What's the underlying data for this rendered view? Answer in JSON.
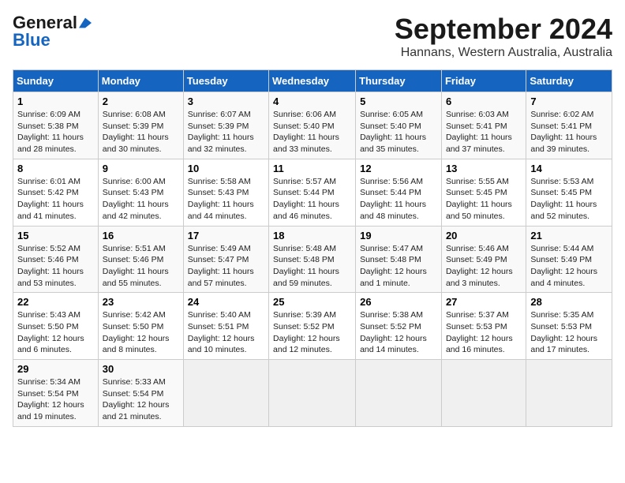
{
  "logo": {
    "line1": "General",
    "line2": "Blue"
  },
  "title": "September 2024",
  "subtitle": "Hannans, Western Australia, Australia",
  "days_of_week": [
    "Sunday",
    "Monday",
    "Tuesday",
    "Wednesday",
    "Thursday",
    "Friday",
    "Saturday"
  ],
  "weeks": [
    [
      {
        "day": "1",
        "info": "Sunrise: 6:09 AM\nSunset: 5:38 PM\nDaylight: 11 hours\nand 28 minutes."
      },
      {
        "day": "2",
        "info": "Sunrise: 6:08 AM\nSunset: 5:39 PM\nDaylight: 11 hours\nand 30 minutes."
      },
      {
        "day": "3",
        "info": "Sunrise: 6:07 AM\nSunset: 5:39 PM\nDaylight: 11 hours\nand 32 minutes."
      },
      {
        "day": "4",
        "info": "Sunrise: 6:06 AM\nSunset: 5:40 PM\nDaylight: 11 hours\nand 33 minutes."
      },
      {
        "day": "5",
        "info": "Sunrise: 6:05 AM\nSunset: 5:40 PM\nDaylight: 11 hours\nand 35 minutes."
      },
      {
        "day": "6",
        "info": "Sunrise: 6:03 AM\nSunset: 5:41 PM\nDaylight: 11 hours\nand 37 minutes."
      },
      {
        "day": "7",
        "info": "Sunrise: 6:02 AM\nSunset: 5:41 PM\nDaylight: 11 hours\nand 39 minutes."
      }
    ],
    [
      {
        "day": "8",
        "info": "Sunrise: 6:01 AM\nSunset: 5:42 PM\nDaylight: 11 hours\nand 41 minutes."
      },
      {
        "day": "9",
        "info": "Sunrise: 6:00 AM\nSunset: 5:43 PM\nDaylight: 11 hours\nand 42 minutes."
      },
      {
        "day": "10",
        "info": "Sunrise: 5:58 AM\nSunset: 5:43 PM\nDaylight: 11 hours\nand 44 minutes."
      },
      {
        "day": "11",
        "info": "Sunrise: 5:57 AM\nSunset: 5:44 PM\nDaylight: 11 hours\nand 46 minutes."
      },
      {
        "day": "12",
        "info": "Sunrise: 5:56 AM\nSunset: 5:44 PM\nDaylight: 11 hours\nand 48 minutes."
      },
      {
        "day": "13",
        "info": "Sunrise: 5:55 AM\nSunset: 5:45 PM\nDaylight: 11 hours\nand 50 minutes."
      },
      {
        "day": "14",
        "info": "Sunrise: 5:53 AM\nSunset: 5:45 PM\nDaylight: 11 hours\nand 52 minutes."
      }
    ],
    [
      {
        "day": "15",
        "info": "Sunrise: 5:52 AM\nSunset: 5:46 PM\nDaylight: 11 hours\nand 53 minutes."
      },
      {
        "day": "16",
        "info": "Sunrise: 5:51 AM\nSunset: 5:46 PM\nDaylight: 11 hours\nand 55 minutes."
      },
      {
        "day": "17",
        "info": "Sunrise: 5:49 AM\nSunset: 5:47 PM\nDaylight: 11 hours\nand 57 minutes."
      },
      {
        "day": "18",
        "info": "Sunrise: 5:48 AM\nSunset: 5:48 PM\nDaylight: 11 hours\nand 59 minutes."
      },
      {
        "day": "19",
        "info": "Sunrise: 5:47 AM\nSunset: 5:48 PM\nDaylight: 12 hours\nand 1 minute."
      },
      {
        "day": "20",
        "info": "Sunrise: 5:46 AM\nSunset: 5:49 PM\nDaylight: 12 hours\nand 3 minutes."
      },
      {
        "day": "21",
        "info": "Sunrise: 5:44 AM\nSunset: 5:49 PM\nDaylight: 12 hours\nand 4 minutes."
      }
    ],
    [
      {
        "day": "22",
        "info": "Sunrise: 5:43 AM\nSunset: 5:50 PM\nDaylight: 12 hours\nand 6 minutes."
      },
      {
        "day": "23",
        "info": "Sunrise: 5:42 AM\nSunset: 5:50 PM\nDaylight: 12 hours\nand 8 minutes."
      },
      {
        "day": "24",
        "info": "Sunrise: 5:40 AM\nSunset: 5:51 PM\nDaylight: 12 hours\nand 10 minutes."
      },
      {
        "day": "25",
        "info": "Sunrise: 5:39 AM\nSunset: 5:52 PM\nDaylight: 12 hours\nand 12 minutes."
      },
      {
        "day": "26",
        "info": "Sunrise: 5:38 AM\nSunset: 5:52 PM\nDaylight: 12 hours\nand 14 minutes."
      },
      {
        "day": "27",
        "info": "Sunrise: 5:37 AM\nSunset: 5:53 PM\nDaylight: 12 hours\nand 16 minutes."
      },
      {
        "day": "28",
        "info": "Sunrise: 5:35 AM\nSunset: 5:53 PM\nDaylight: 12 hours\nand 17 minutes."
      }
    ],
    [
      {
        "day": "29",
        "info": "Sunrise: 5:34 AM\nSunset: 5:54 PM\nDaylight: 12 hours\nand 19 minutes."
      },
      {
        "day": "30",
        "info": "Sunrise: 5:33 AM\nSunset: 5:54 PM\nDaylight: 12 hours\nand 21 minutes."
      },
      {
        "day": "",
        "info": ""
      },
      {
        "day": "",
        "info": ""
      },
      {
        "day": "",
        "info": ""
      },
      {
        "day": "",
        "info": ""
      },
      {
        "day": "",
        "info": ""
      }
    ]
  ]
}
